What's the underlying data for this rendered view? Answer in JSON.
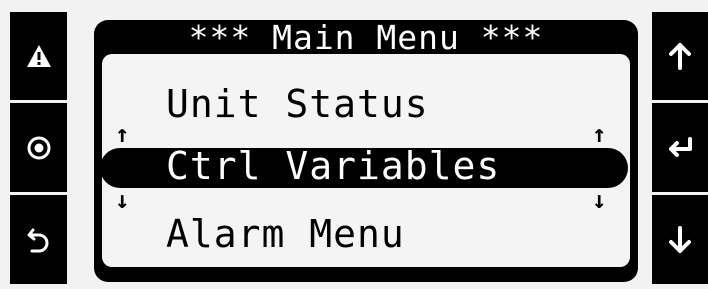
{
  "menu": {
    "title": "*** Main Menu ***",
    "items": [
      {
        "label": "Unit Status"
      },
      {
        "label": "Ctrl Variables"
      },
      {
        "label": "Alarm Menu"
      }
    ],
    "selected_index": 1,
    "scroll_up_glyph": "↑",
    "scroll_down_glyph": "↓"
  },
  "buttons": {
    "left": [
      "warning-icon",
      "record-icon",
      "back-icon"
    ],
    "right": [
      "arrow-up-icon",
      "enter-icon",
      "arrow-down-icon"
    ]
  },
  "colors": {
    "panel": "#000000",
    "screen": "#f4f4f4",
    "background": "#f2f2f2"
  }
}
